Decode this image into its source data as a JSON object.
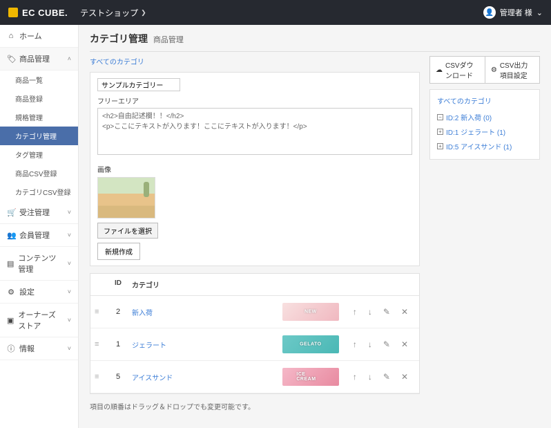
{
  "header": {
    "brand": "EC CUBE.",
    "shop": "テストショップ",
    "user": "管理者 様"
  },
  "nav": {
    "home": "ホーム",
    "product": "商品管理",
    "product_children": {
      "list": "商品一覧",
      "reg": "商品登録",
      "spec": "規格管理",
      "cat": "カテゴリ管理",
      "tag": "タグ管理",
      "pcsv": "商品CSV登録",
      "ccsv": "カテゴリCSV登録"
    },
    "order": "受注管理",
    "member": "会員管理",
    "content": "コンテンツ管理",
    "setting": "設定",
    "owners": "オーナーズストア",
    "info": "情報"
  },
  "page": {
    "title": "カテゴリ管理",
    "subtitle": "商品管理",
    "breadcrumb": "すべてのカテゴリ",
    "name_value": "サンプルカテゴリー",
    "free_label": "フリーエリア",
    "free_value": "<h2>自由記述欄！！</h2>\n<p>ここにテキストが入ります！ここにテキストが入ります！</p>",
    "img_label": "画像",
    "file_btn": "ファイルを選択",
    "submit": "新規作成",
    "col_id": "ID",
    "col_cat": "カテゴリ",
    "rows": [
      {
        "id": "2",
        "name": "新入荷",
        "thumb_text": "NEW"
      },
      {
        "id": "1",
        "name": "ジェラート",
        "thumb_text": "GELATO"
      },
      {
        "id": "5",
        "name": "アイスサンド",
        "thumb_text": "ICE CREAM"
      }
    ],
    "footnote": "項目の順番はドラッグ＆ドロップでも変更可能です。"
  },
  "side": {
    "csv_dl": "CSVダウンロード",
    "csv_cfg": "CSV出力項目設定",
    "tree_title": "すべてのカテゴリ",
    "tree": [
      {
        "sym": "−",
        "label": "ID:2 新入荷 (0)"
      },
      {
        "sym": "+",
        "label": "ID:1 ジェラート (1)"
      },
      {
        "sym": "+",
        "label": "ID:5 アイスサンド (1)"
      }
    ]
  }
}
